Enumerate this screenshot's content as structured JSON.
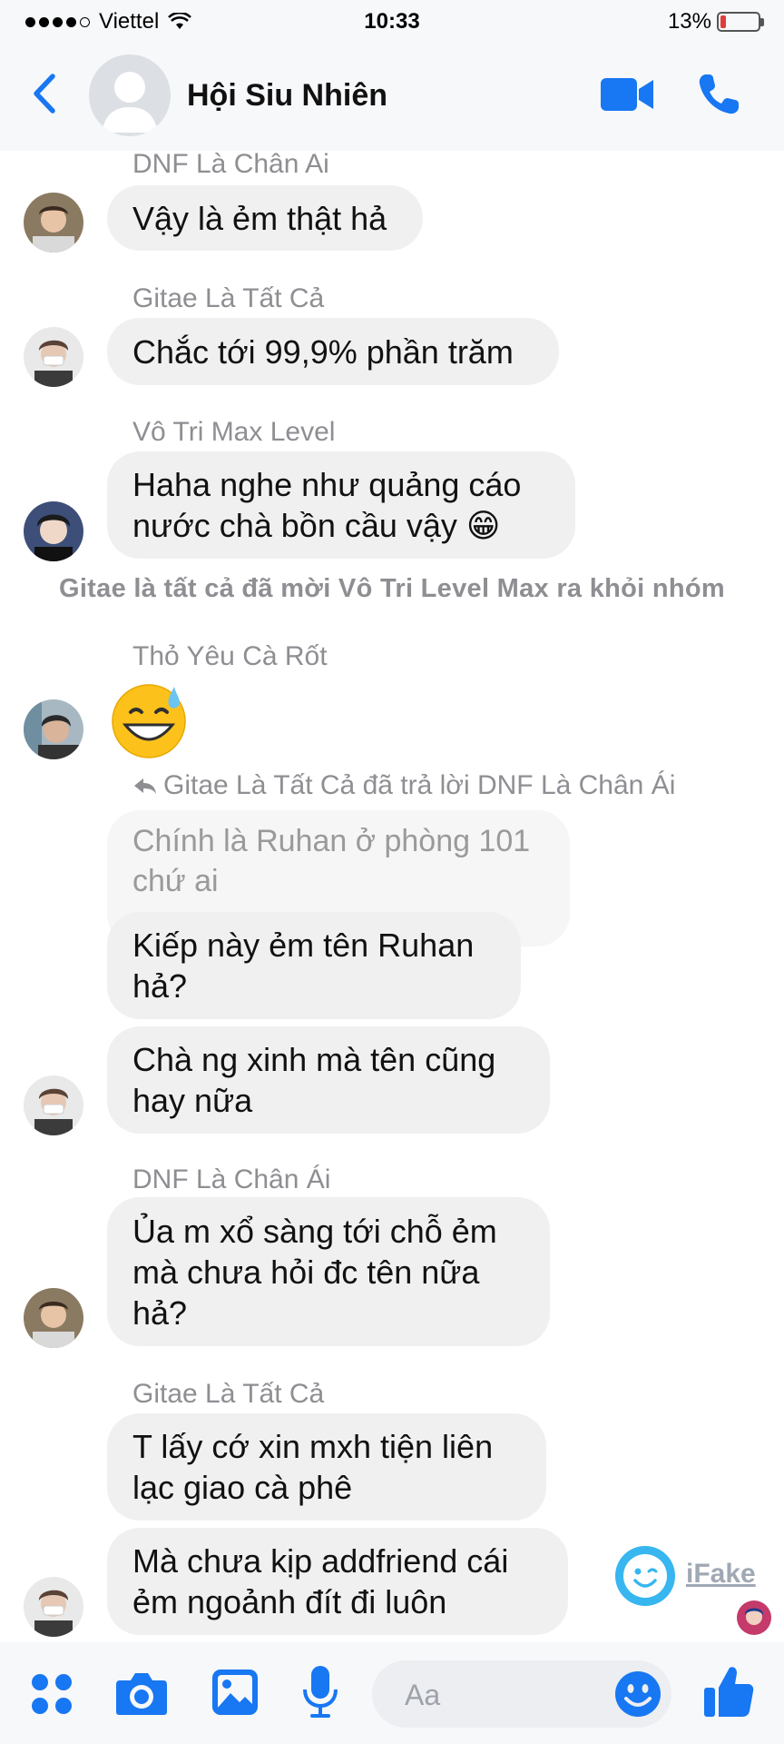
{
  "status_bar": {
    "carrier": "Viettel",
    "time": "10:33",
    "battery": "13%"
  },
  "header": {
    "title": "Hội Siu Nhiên"
  },
  "messages": [
    {
      "sender": "DNF Là Chân Ai",
      "bubbles": [
        [
          "Vậy là ẻm thật hả"
        ]
      ]
    },
    {
      "sender": "Gitae Là Tất Cả",
      "bubbles": [
        [
          "Chắc tới 99,9% phần trăm"
        ]
      ]
    },
    {
      "sender": "Vô Tri Max Level",
      "bubbles": [
        [
          "Haha nghe như quảng cáo",
          "nước chà bồn cầu vậy 😁"
        ]
      ]
    },
    {
      "sender": "Thỏ Yêu Cà Rốt",
      "emoji": "😅"
    },
    {
      "sender": "DNF Là Chân Ái",
      "bubbles": [
        [
          "Ủa m xổ sàng tới chỗ ẻm",
          "mà chưa hỏi đc tên nữa",
          "hả?"
        ]
      ]
    },
    {
      "sender": "Gitae Là Tất Cả",
      "bubbles": [
        [
          "T lấy cớ xin mxh tiện liên",
          "lạc giao cà phê"
        ],
        [
          "Mà chưa kịp addfriend cái",
          "ẻm ngoảnh đít đi luôn"
        ]
      ]
    }
  ],
  "system_note": "Gitae là tất cả đã mời Vô Tri Level Max ra khỏi nhóm",
  "reply_block": {
    "note": "Gitae Là Tất Cả đã trả lời DNF Là Chân Ái",
    "quoted": [
      "Chính là Ruhan ở phòng 101",
      "chứ ai"
    ],
    "bubbles": [
      [
        "Kiếp này ẻm tên Ruhan",
        "hả?"
      ],
      [
        "Chà ng xinh mà tên cũng",
        "hay nữa"
      ]
    ]
  },
  "watermark": "iFake",
  "composer": {
    "placeholder": "Aa"
  },
  "colors": {
    "accent": "#1877f2",
    "bubble": "#f1f0f0",
    "muted_text": "#8e8e93"
  },
  "icons": [
    "back-icon",
    "video-call-icon",
    "phone-icon",
    "apps-icon",
    "camera-icon",
    "gallery-icon",
    "microphone-icon",
    "emoji-icon",
    "like-icon"
  ]
}
